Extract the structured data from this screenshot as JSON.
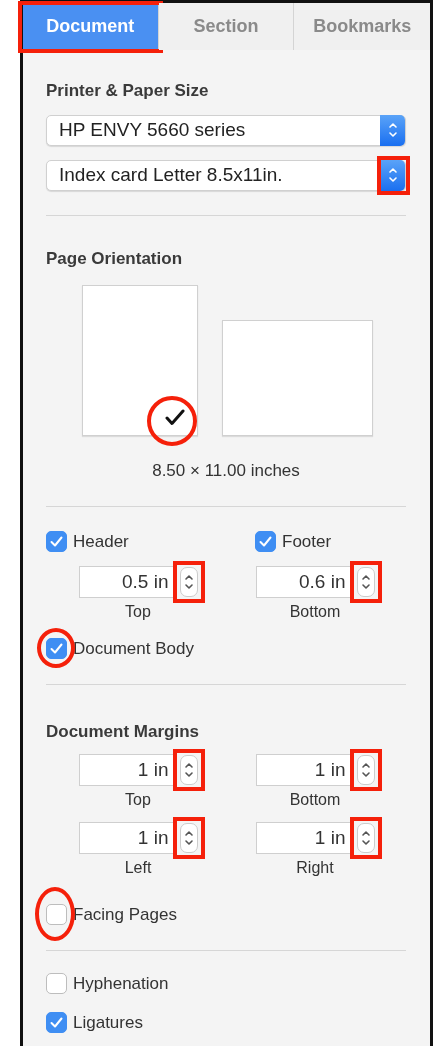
{
  "tabs": [
    {
      "label": "Document",
      "selected": true,
      "highlighted": true
    },
    {
      "label": "Section",
      "selected": false
    },
    {
      "label": "Bookmarks",
      "selected": false
    }
  ],
  "printer_section": {
    "heading": "Printer & Paper Size",
    "popups": [
      {
        "value": "HP ENVY 5660 series"
      },
      {
        "value": "Index card Letter 8.5x11in.",
        "highlighted": true
      }
    ]
  },
  "orientation_section": {
    "heading": "Page Orientation",
    "options": [
      {
        "kind": "portrait",
        "selected": true,
        "highlighted": true
      },
      {
        "kind": "landscape",
        "selected": false
      }
    ],
    "size_text": "8.50 × 11.00 inches"
  },
  "header_footer": {
    "columns": [
      {
        "label": "Header",
        "checked": true,
        "value": "0.5 in",
        "caption": "Top",
        "highlighted": true
      },
      {
        "label": "Footer",
        "checked": true,
        "value": "0.6 in",
        "caption": "Bottom",
        "highlighted": true
      }
    ],
    "document_body": {
      "label": "Document Body",
      "checked": true,
      "highlighted": true
    }
  },
  "margins": {
    "heading": "Document Margins",
    "fields": [
      {
        "value": "1 in",
        "caption": "Top",
        "highlighted": true
      },
      {
        "value": "1 in",
        "caption": "Bottom",
        "highlighted": true
      },
      {
        "value": "1 in",
        "caption": "Left",
        "highlighted": true
      },
      {
        "value": "1 in",
        "caption": "Right",
        "highlighted": true
      }
    ],
    "facing_pages": {
      "label": "Facing Pages",
      "checked": false,
      "highlighted": true
    }
  },
  "options": [
    {
      "label": "Hyphenation",
      "checked": false
    },
    {
      "label": "Ligatures",
      "checked": true
    }
  ]
}
